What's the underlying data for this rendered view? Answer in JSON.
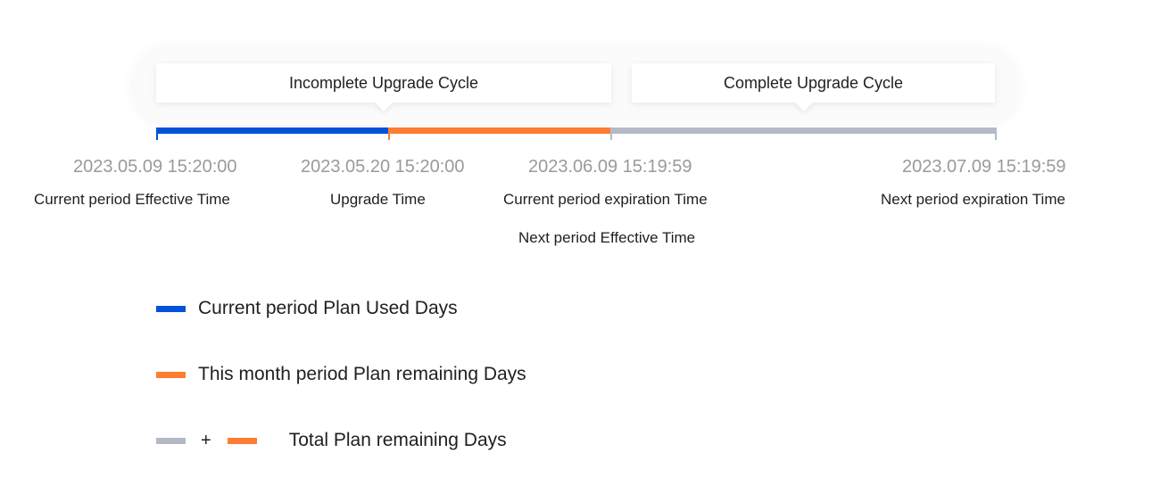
{
  "cycles": {
    "incomplete": "Incomplete Upgrade Cycle",
    "complete": "Complete Upgrade Cycle"
  },
  "colors": {
    "used": "#0052d9",
    "remaining": "#ff7d32",
    "next": "#b3bac6"
  },
  "timeline": [
    {
      "date": "2023.05.09 15:20:00",
      "captions": [
        "Current period Effective Time"
      ]
    },
    {
      "date": "2023.05.20 15:20:00",
      "captions": [
        "Upgrade Time"
      ]
    },
    {
      "date": "2023.06.09 15:19:59",
      "captions": [
        "Current period expiration Time",
        "Next period Effective Time"
      ]
    },
    {
      "date": "2023.07.09 15:19:59",
      "captions": [
        "Next period expiration Time"
      ]
    }
  ],
  "legend": {
    "used": "Current period Plan Used Days",
    "month_remaining": "This month period Plan remaining Days",
    "plus": "+",
    "total_remaining": "Total Plan remaining Days"
  }
}
